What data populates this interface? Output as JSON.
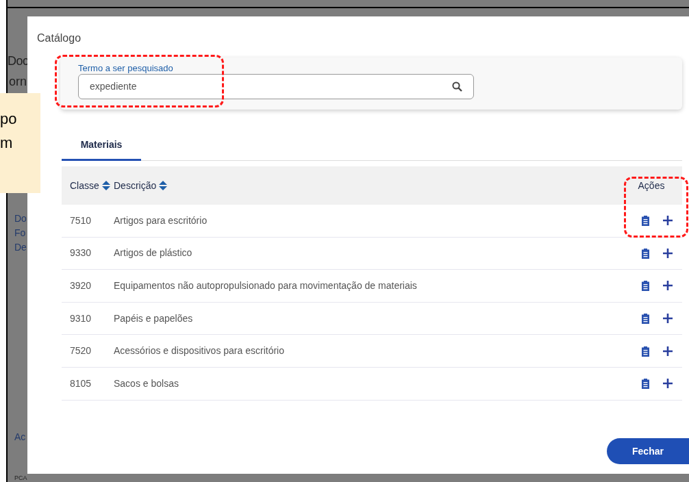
{
  "background": {
    "side_texts": [
      {
        "text": "Doc",
        "kind": "heading"
      },
      {
        "text": "orn",
        "kind": "heading"
      },
      {
        "text": "Do",
        "kind": "link"
      },
      {
        "text": "Fo",
        "kind": "link"
      },
      {
        "text": "De",
        "kind": "link"
      },
      {
        "text": "Ac",
        "kind": "link"
      },
      {
        "text": "PCA",
        "kind": "heading"
      }
    ]
  },
  "callout": {
    "lines": [
      "po",
      "m"
    ]
  },
  "modal": {
    "title": "Catálogo",
    "search": {
      "label": "Termo a ser pesquisado",
      "value": "expediente"
    },
    "tabs": [
      {
        "label": "Materiais",
        "selected": true
      }
    ],
    "table": {
      "columns": [
        {
          "label": "Classe",
          "sortable": true
        },
        {
          "label": "Descrição",
          "sortable": true
        },
        {
          "label": "Ações",
          "sortable": false
        }
      ],
      "rows": [
        {
          "classe": "7510",
          "descricao": "Artigos para escritório"
        },
        {
          "classe": "9330",
          "descricao": "Artigos de plástico"
        },
        {
          "classe": "3920",
          "descricao": "Equipamentos não autopropulsionado para movimentação de materiais"
        },
        {
          "classe": "9310",
          "descricao": "Papéis e papelões"
        },
        {
          "classe": "7520",
          "descricao": "Acessórios e dispositivos para escritório"
        },
        {
          "classe": "8105",
          "descricao": "Sacos e bolsas"
        }
      ]
    },
    "close_button": "Fechar"
  }
}
